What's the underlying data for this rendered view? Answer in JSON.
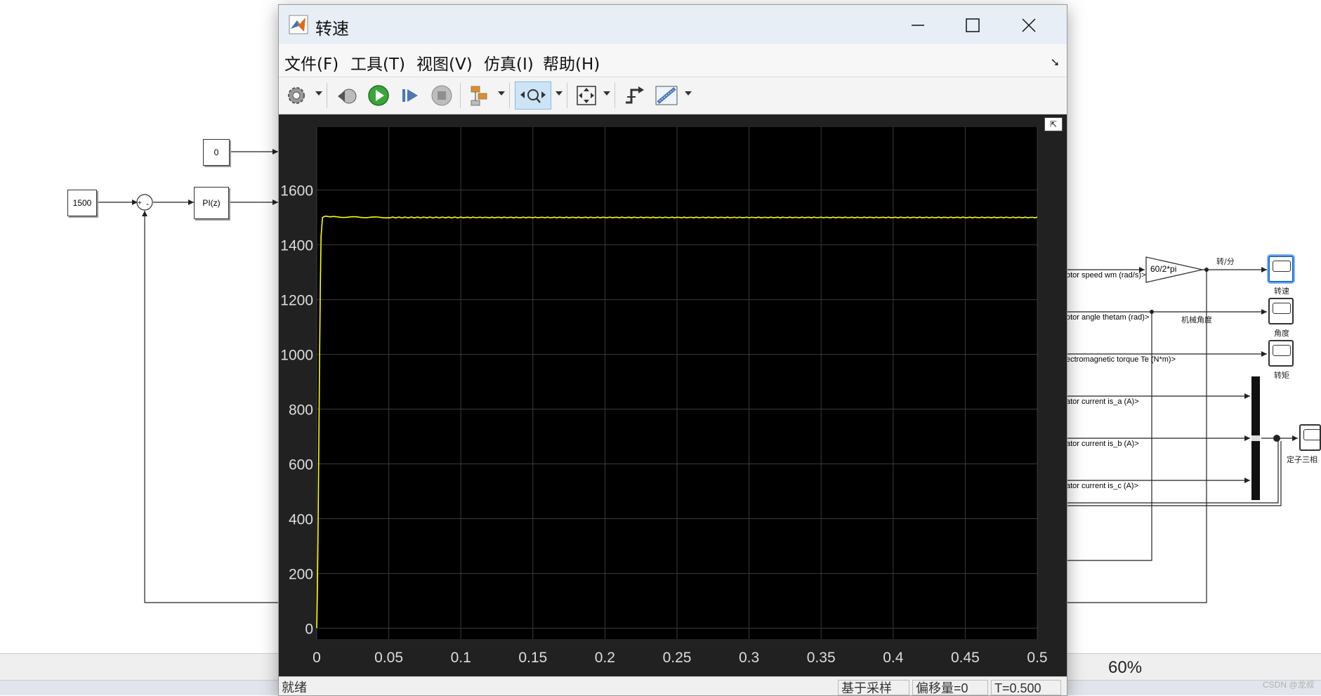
{
  "window": {
    "title": "转速",
    "minimize_icon": "minimize-icon",
    "maximize_icon": "maximize-icon",
    "close_icon": "close-icon"
  },
  "menu": [
    {
      "label": "文件(F)"
    },
    {
      "label": "工具(T)"
    },
    {
      "label": "视图(V)"
    },
    {
      "label": "仿真(I)"
    },
    {
      "label": "帮助(H)"
    }
  ],
  "toolbar_icons": [
    "settings-gear-icon",
    "step-back-icon",
    "run-icon",
    "step-forward-icon",
    "stop-icon",
    "signal-select-icon",
    "zoom-x-icon",
    "autoscale-icon",
    "trigger-icon",
    "measurement-icon"
  ],
  "status": {
    "ready": "就绪",
    "sample": "基于采样",
    "offset": "偏移量=0",
    "time": "T=0.500"
  },
  "zoom": "60%",
  "watermark": "CSDN @龙叔",
  "colors": {
    "plot_background": "#000000",
    "trace": "#ffff00",
    "grid": "#3a3a3a",
    "tick_text": "#dddddd"
  },
  "chart_data": {
    "type": "line",
    "title": "",
    "xlabel": "",
    "ylabel": "",
    "xlim": [
      0,
      0.5
    ],
    "ylim": [
      -40,
      1830
    ],
    "xticks": [
      "0",
      "0.05",
      "0.1",
      "0.15",
      "0.2",
      "0.25",
      "0.3",
      "0.35",
      "0.4",
      "0.45",
      "0.5"
    ],
    "yticks": [
      "0",
      "200",
      "400",
      "600",
      "800",
      "1000",
      "1200",
      "1400",
      "1600"
    ],
    "grid": true,
    "series": [
      {
        "color": "#ffff00",
        "x": [
          0,
          0.0005,
          0.001,
          0.0015,
          0.002,
          0.0025,
          0.003,
          0.004,
          0.006,
          0.01,
          0.05,
          0.1,
          0.2,
          0.3,
          0.4,
          0.5
        ],
        "y": [
          0,
          150,
          400,
          700,
          1000,
          1250,
          1430,
          1500,
          1505,
          1502,
          1500,
          1500,
          1500,
          1500,
          1500,
          1500
        ]
      }
    ]
  },
  "simulink": {
    "const_zero": "0",
    "const_1500": "1500",
    "pi_block": "PI(z)",
    "gain": "60/2*pi",
    "rpm_label": "转/分",
    "signals": [
      {
        "label": "otor speed wm (rad/s)>"
      },
      {
        "label": "otor angle thetam (rad)>"
      },
      {
        "label": "ectromagnetic torque Te (N*m)>"
      },
      {
        "label": "ator current is_a (A)>"
      },
      {
        "label": "ator current is_b (A)>"
      },
      {
        "label": "ator current is_c (A)>"
      }
    ],
    "scopes": [
      {
        "label": "转速"
      },
      {
        "label": "角度"
      },
      {
        "label": "转矩"
      },
      {
        "label": "定子三相"
      }
    ],
    "mech_angle": "机械角度"
  }
}
